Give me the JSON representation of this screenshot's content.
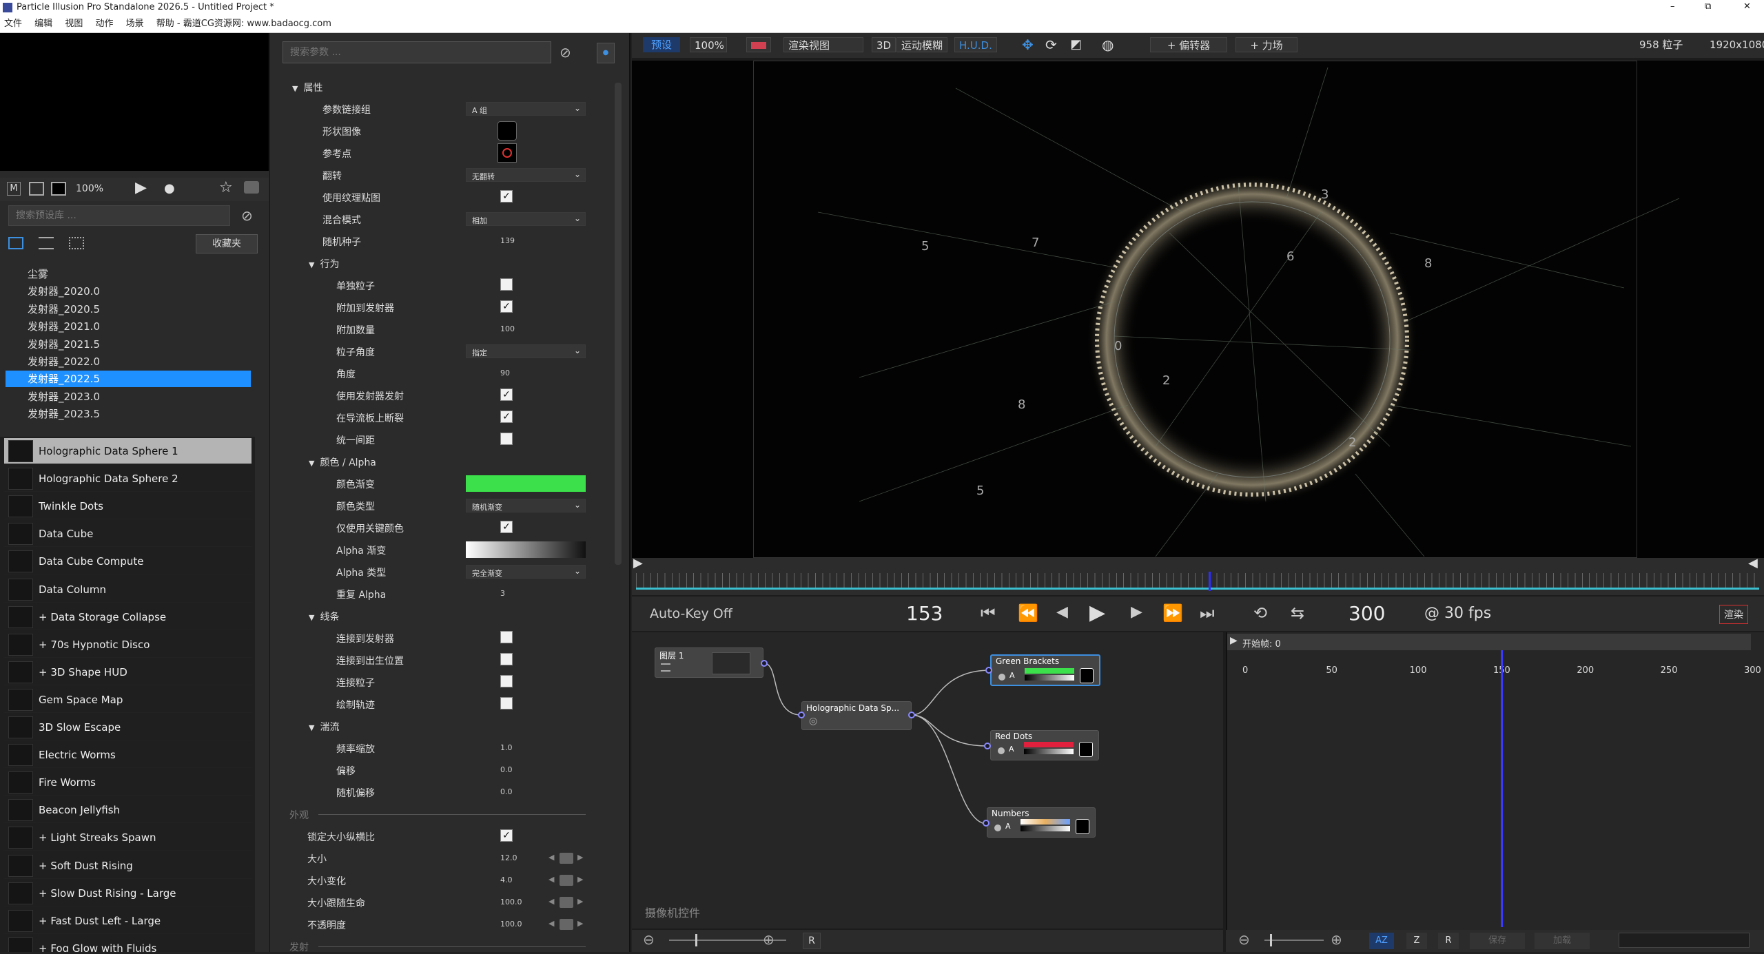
{
  "window": {
    "title": "Particle Illusion Pro Standalone 2026.5 - Untitled Project *",
    "controls": [
      "–",
      "⧉",
      "✕"
    ]
  },
  "menu": [
    "文件",
    "编辑",
    "视图",
    "动作",
    "场景",
    "帮助 - 霸道CG资源网: www.badaocg.com"
  ],
  "left": {
    "mode_m": "M",
    "zoom": "100%",
    "search_placeholder": "搜索预设库 ...",
    "favorites_label": "收藏夹",
    "emitter_groups": [
      "尘雾",
      "发射器_2020.0",
      "发射器_2020.5",
      "发射器_2021.0",
      "发射器_2021.5",
      "发射器_2022.0",
      "发射器_2022.5",
      "发射器_2023.0",
      "发射器_2023.5"
    ],
    "selected_group_index": 6,
    "presets": [
      "Holographic Data Sphere 1",
      "Holographic Data Sphere 2",
      "Twinkle Dots",
      "Data Cube",
      "Data Cube Compute",
      "Data Column",
      "+ Data Storage Collapse",
      "+ 70s Hypnotic Disco",
      "+ 3D Shape HUD",
      "Gem Space Map",
      "3D Slow Escape",
      "Electric Worms",
      "Fire Worms",
      "Beacon Jellyfish",
      "+ Light Streaks Spawn",
      "+ Soft Dust Rising",
      "+ Slow Dust Rising - Large",
      "+ Fast Dust Left - Large",
      "+ Fog Glow with Fluids"
    ],
    "selected_preset_index": 0
  },
  "params": {
    "search_placeholder": "搜索参数 ...",
    "sections": {
      "attributes": "属性",
      "behavior": "行为",
      "color_alpha": "颜色 / Alpha",
      "lines": "线条",
      "turbulence": "湍流",
      "appearance": "外观",
      "emission": "发射"
    },
    "rows": {
      "link_group": {
        "label": "参数链接组",
        "value": "A 组"
      },
      "shape_image": {
        "label": "形状图像"
      },
      "ref_point": {
        "label": "参考点"
      },
      "flip": {
        "label": "翻转",
        "value": "无翻转"
      },
      "use_texture": {
        "label": "使用纹理贴图"
      },
      "blend_mode": {
        "label": "混合模式",
        "value": "相加"
      },
      "random_seed": {
        "label": "随机种子",
        "value": "139"
      },
      "single_particle": {
        "label": "单独粒子"
      },
      "attach_emitter": {
        "label": "附加到发射器"
      },
      "attach_count": {
        "label": "附加数量",
        "value": "100"
      },
      "particle_angle": {
        "label": "粒子角度",
        "value": "指定"
      },
      "angle": {
        "label": "角度",
        "value": "90"
      },
      "use_emitter_emit": {
        "label": "使用发射器发射"
      },
      "break_on_guide": {
        "label": "在导流板上断裂"
      },
      "uniform_spacing": {
        "label": "统一间距"
      },
      "color_gradient": {
        "label": "颜色渐变"
      },
      "color_type": {
        "label": "颜色类型",
        "value": "随机渐变"
      },
      "key_colors_only": {
        "label": "仅使用关键颜色"
      },
      "alpha_gradient": {
        "label": "Alpha 渐变"
      },
      "alpha_type": {
        "label": "Alpha 类型",
        "value": "完全渐变"
      },
      "repeat_alpha": {
        "label": "重复 Alpha",
        "value": "3"
      },
      "connect_emitter": {
        "label": "连接到发射器"
      },
      "connect_birth": {
        "label": "连接到出生位置"
      },
      "connect_particles": {
        "label": "连接粒子"
      },
      "draw_trail": {
        "label": "绘制轨迹"
      },
      "freq_scale": {
        "label": "频率缩放",
        "value": "1.0"
      },
      "offset": {
        "label": "偏移",
        "value": "0.0"
      },
      "random_offset": {
        "label": "随机偏移",
        "value": "0.0"
      },
      "lock_aspect": {
        "label": "锁定大小纵横比"
      },
      "size": {
        "label": "大小",
        "value": "12.0"
      },
      "size_var": {
        "label": "大小变化",
        "value": "4.0"
      },
      "size_over_life": {
        "label": "大小跟随生命",
        "value": "100.0"
      },
      "opacity": {
        "label": "不透明度",
        "value": "100.0"
      }
    },
    "checks": {
      "use_texture": true,
      "single_particle": false,
      "attach_emitter": true,
      "use_emitter_emit": true,
      "break_on_guide": true,
      "uniform_spacing": false,
      "key_colors_only": true,
      "connect_emitter": false,
      "connect_birth": false,
      "connect_particles": false,
      "draw_trail": false,
      "lock_aspect": true
    },
    "color_gradient_hex": "#3be04a"
  },
  "toolbar": {
    "preview": "预设",
    "zoom": "100%",
    "render_view": "渲染视图",
    "three_d": "3D",
    "motion_blur": "运动模糊",
    "hud": "H.U.D.",
    "add_deflector": "+ 偏转器",
    "add_force": "+ 力场",
    "particle_count": "958 粒子",
    "resolution": "1920x1080"
  },
  "transport": {
    "autokey": "Auto-Key Off",
    "current_frame": "153",
    "end_frame": "300",
    "fps": "@ 30 fps",
    "render": "渲染"
  },
  "nodes": {
    "layer": "图层 1",
    "emitter": "Holographic Data Sp...",
    "green": "Green Brackets",
    "red": "Red Dots",
    "numbers": "Numbers",
    "alpha_a": "A",
    "camera_controls": "摄像机控件"
  },
  "timeline": {
    "start_frame": "开始帧: 0",
    "ticks": [
      "0",
      "50",
      "100",
      "150",
      "200",
      "250",
      "300"
    ],
    "playhead_frame": 153
  },
  "bottom": {
    "r1": "R",
    "az": "AZ",
    "z": "Z",
    "r2": "R",
    "save": "保存",
    "load": "加载"
  },
  "colors": {
    "accent": "#1e90ff",
    "playhead": "#2f2fff",
    "red": "#e0203c"
  },
  "icons": [
    "monitor-icon",
    "grid-icon",
    "play-icon",
    "record-icon",
    "star-icon",
    "camera-icon",
    "list-view-icon",
    "thumb-view-icon",
    "clear-icon",
    "move-icon",
    "rotate-icon",
    "scale-icon",
    "globe-icon",
    "skip-start-icon",
    "rewind-icon",
    "step-back-icon",
    "step-fwd-icon",
    "fast-forward-icon",
    "skip-end-icon",
    "loop-icon",
    "pingpong-icon",
    "zoom-out-icon",
    "zoom-in-icon"
  ]
}
